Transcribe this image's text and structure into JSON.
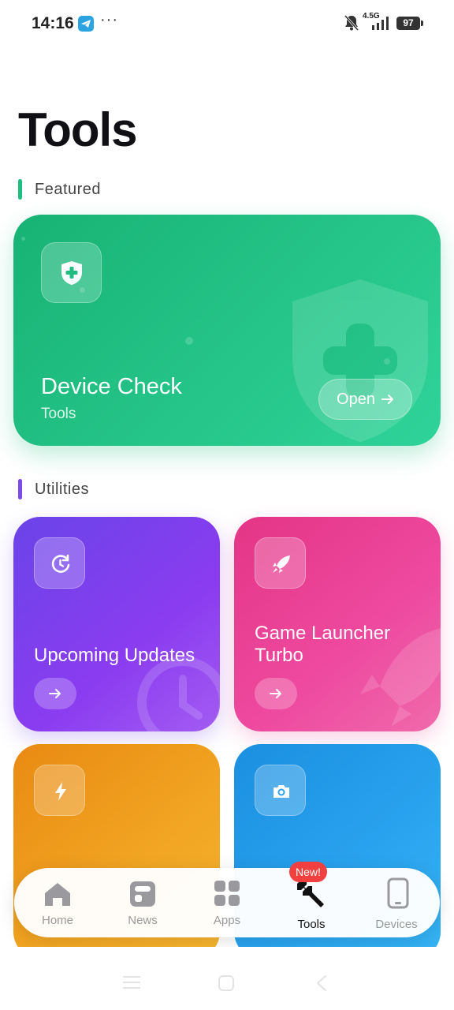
{
  "status": {
    "time": "14:16",
    "network": "4.5G",
    "battery": "97"
  },
  "page": {
    "title": "Tools"
  },
  "featured": {
    "section_label": "Featured",
    "section_color": "#1fbf80",
    "card": {
      "title": "Device Check",
      "subtitle": "Tools",
      "button_label": "Open",
      "icon": "shield-plus-icon"
    }
  },
  "utilities": {
    "section_label": "Utilities",
    "section_color": "#7b4ae8",
    "tiles": [
      {
        "title": "Upcoming Updates",
        "icon": "clock-refresh-icon",
        "color": "#7a3fee"
      },
      {
        "title": "Game Launcher Turbo",
        "icon": "rocket-icon",
        "color": "#e83e90"
      },
      {
        "title": "",
        "icon": "lightning-icon",
        "color": "#f0a01e"
      },
      {
        "title": "",
        "icon": "camera-icon",
        "color": "#27a2ee"
      }
    ]
  },
  "nav": {
    "items": [
      {
        "label": "Home",
        "icon": "home-icon"
      },
      {
        "label": "News",
        "icon": "news-icon"
      },
      {
        "label": "Apps",
        "icon": "apps-grid-icon"
      },
      {
        "label": "Tools",
        "icon": "wrench-icon",
        "active": true
      },
      {
        "label": "Devices",
        "icon": "phone-icon"
      }
    ],
    "badge": "New!"
  }
}
